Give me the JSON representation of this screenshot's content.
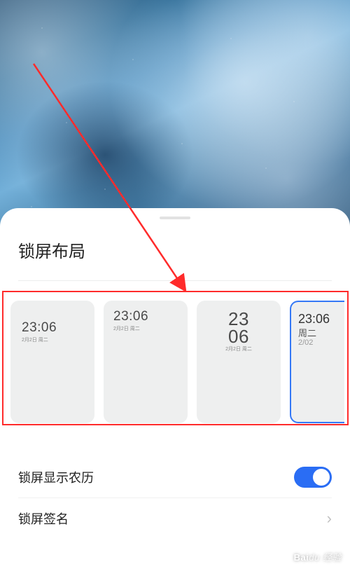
{
  "panel": {
    "title": "锁屏布局",
    "layouts": [
      {
        "time": "23:06",
        "sub": "2月2日 周二"
      },
      {
        "time": "23:06",
        "sub": "2月2日 周二"
      },
      {
        "time_top": "23",
        "time_bottom": "06",
        "sub": "2月2日 周二"
      },
      {
        "time": "23:06",
        "day": "周二",
        "date": "2/02"
      }
    ]
  },
  "settings": {
    "lunar_label": "锁屏显示农历",
    "signature_label": "锁屏签名"
  },
  "watermark": {
    "brand": "Bai",
    "brand2": "du",
    "text": "经验"
  }
}
